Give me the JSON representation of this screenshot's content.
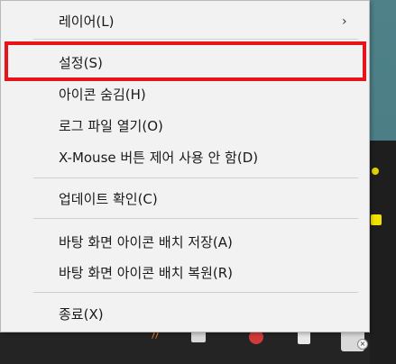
{
  "menu": {
    "items": [
      {
        "label": "레이어(L)",
        "submenu": true
      },
      {
        "label": "설정(S)"
      },
      {
        "label": "아이콘 숨김(H)"
      },
      {
        "label": "로그 파일 열기(O)"
      },
      {
        "label": "X-Mouse 버튼 제어 사용 안 함(D)"
      },
      {
        "label": "업데이트 확인(C)"
      },
      {
        "label": "바탕 화면 아이콘 배치 저장(A)"
      },
      {
        "label": "바탕 화면 아이콘 배치 복원(R)"
      },
      {
        "label": "종료(X)"
      }
    ],
    "submenu_arrow": "›",
    "highlight_color": "#e8131b"
  },
  "tray": {
    "icons": [
      "chart-icon",
      "window-icon",
      "media-icon",
      "document-icon",
      "notification-icon"
    ],
    "badge": "×"
  }
}
